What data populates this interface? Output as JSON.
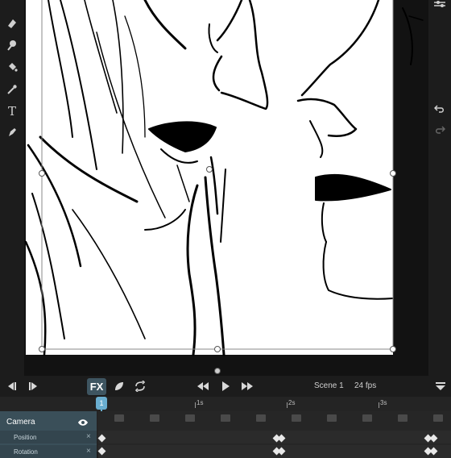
{
  "tools": [
    "eraser-icon",
    "smudge-icon",
    "fill-bucket-icon",
    "eyedropper-icon",
    "text-tool-icon",
    "pen-tool-icon"
  ],
  "text_tool_glyph": "T",
  "transport": {
    "fx_label": "FX",
    "scene_label": "Scene 1",
    "fps_label": "24 fps"
  },
  "ruler": {
    "current_frame": "1",
    "marks": [
      "1s",
      "2s",
      "3s"
    ]
  },
  "layer": {
    "name": "Camera",
    "properties": [
      "Position",
      "Rotation"
    ]
  },
  "colors": {
    "accent": "#6aaed0",
    "layer_panel": "#3a4f59",
    "fx_active": "#3e5561"
  }
}
